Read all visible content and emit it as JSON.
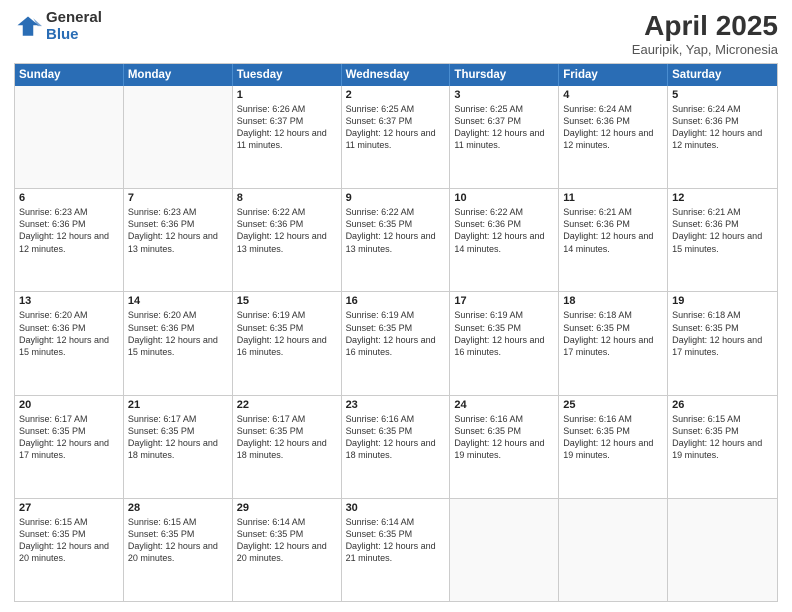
{
  "logo": {
    "general": "General",
    "blue": "Blue"
  },
  "header": {
    "title": "April 2025",
    "location": "Eauripik, Yap, Micronesia"
  },
  "days_of_week": [
    "Sunday",
    "Monday",
    "Tuesday",
    "Wednesday",
    "Thursday",
    "Friday",
    "Saturday"
  ],
  "weeks": [
    [
      {
        "day": "",
        "info": ""
      },
      {
        "day": "",
        "info": ""
      },
      {
        "day": "1",
        "info": "Sunrise: 6:26 AM\nSunset: 6:37 PM\nDaylight: 12 hours and 11 minutes."
      },
      {
        "day": "2",
        "info": "Sunrise: 6:25 AM\nSunset: 6:37 PM\nDaylight: 12 hours and 11 minutes."
      },
      {
        "day": "3",
        "info": "Sunrise: 6:25 AM\nSunset: 6:37 PM\nDaylight: 12 hours and 11 minutes."
      },
      {
        "day": "4",
        "info": "Sunrise: 6:24 AM\nSunset: 6:36 PM\nDaylight: 12 hours and 12 minutes."
      },
      {
        "day": "5",
        "info": "Sunrise: 6:24 AM\nSunset: 6:36 PM\nDaylight: 12 hours and 12 minutes."
      }
    ],
    [
      {
        "day": "6",
        "info": "Sunrise: 6:23 AM\nSunset: 6:36 PM\nDaylight: 12 hours and 12 minutes."
      },
      {
        "day": "7",
        "info": "Sunrise: 6:23 AM\nSunset: 6:36 PM\nDaylight: 12 hours and 13 minutes."
      },
      {
        "day": "8",
        "info": "Sunrise: 6:22 AM\nSunset: 6:36 PM\nDaylight: 12 hours and 13 minutes."
      },
      {
        "day": "9",
        "info": "Sunrise: 6:22 AM\nSunset: 6:35 PM\nDaylight: 12 hours and 13 minutes."
      },
      {
        "day": "10",
        "info": "Sunrise: 6:22 AM\nSunset: 6:36 PM\nDaylight: 12 hours and 14 minutes."
      },
      {
        "day": "11",
        "info": "Sunrise: 6:21 AM\nSunset: 6:36 PM\nDaylight: 12 hours and 14 minutes."
      },
      {
        "day": "12",
        "info": "Sunrise: 6:21 AM\nSunset: 6:36 PM\nDaylight: 12 hours and 15 minutes."
      }
    ],
    [
      {
        "day": "13",
        "info": "Sunrise: 6:20 AM\nSunset: 6:36 PM\nDaylight: 12 hours and 15 minutes."
      },
      {
        "day": "14",
        "info": "Sunrise: 6:20 AM\nSunset: 6:36 PM\nDaylight: 12 hours and 15 minutes."
      },
      {
        "day": "15",
        "info": "Sunrise: 6:19 AM\nSunset: 6:35 PM\nDaylight: 12 hours and 16 minutes."
      },
      {
        "day": "16",
        "info": "Sunrise: 6:19 AM\nSunset: 6:35 PM\nDaylight: 12 hours and 16 minutes."
      },
      {
        "day": "17",
        "info": "Sunrise: 6:19 AM\nSunset: 6:35 PM\nDaylight: 12 hours and 16 minutes."
      },
      {
        "day": "18",
        "info": "Sunrise: 6:18 AM\nSunset: 6:35 PM\nDaylight: 12 hours and 17 minutes."
      },
      {
        "day": "19",
        "info": "Sunrise: 6:18 AM\nSunset: 6:35 PM\nDaylight: 12 hours and 17 minutes."
      }
    ],
    [
      {
        "day": "20",
        "info": "Sunrise: 6:17 AM\nSunset: 6:35 PM\nDaylight: 12 hours and 17 minutes."
      },
      {
        "day": "21",
        "info": "Sunrise: 6:17 AM\nSunset: 6:35 PM\nDaylight: 12 hours and 18 minutes."
      },
      {
        "day": "22",
        "info": "Sunrise: 6:17 AM\nSunset: 6:35 PM\nDaylight: 12 hours and 18 minutes."
      },
      {
        "day": "23",
        "info": "Sunrise: 6:16 AM\nSunset: 6:35 PM\nDaylight: 12 hours and 18 minutes."
      },
      {
        "day": "24",
        "info": "Sunrise: 6:16 AM\nSunset: 6:35 PM\nDaylight: 12 hours and 19 minutes."
      },
      {
        "day": "25",
        "info": "Sunrise: 6:16 AM\nSunset: 6:35 PM\nDaylight: 12 hours and 19 minutes."
      },
      {
        "day": "26",
        "info": "Sunrise: 6:15 AM\nSunset: 6:35 PM\nDaylight: 12 hours and 19 minutes."
      }
    ],
    [
      {
        "day": "27",
        "info": "Sunrise: 6:15 AM\nSunset: 6:35 PM\nDaylight: 12 hours and 20 minutes."
      },
      {
        "day": "28",
        "info": "Sunrise: 6:15 AM\nSunset: 6:35 PM\nDaylight: 12 hours and 20 minutes."
      },
      {
        "day": "29",
        "info": "Sunrise: 6:14 AM\nSunset: 6:35 PM\nDaylight: 12 hours and 20 minutes."
      },
      {
        "day": "30",
        "info": "Sunrise: 6:14 AM\nSunset: 6:35 PM\nDaylight: 12 hours and 21 minutes."
      },
      {
        "day": "",
        "info": ""
      },
      {
        "day": "",
        "info": ""
      },
      {
        "day": "",
        "info": ""
      }
    ]
  ]
}
